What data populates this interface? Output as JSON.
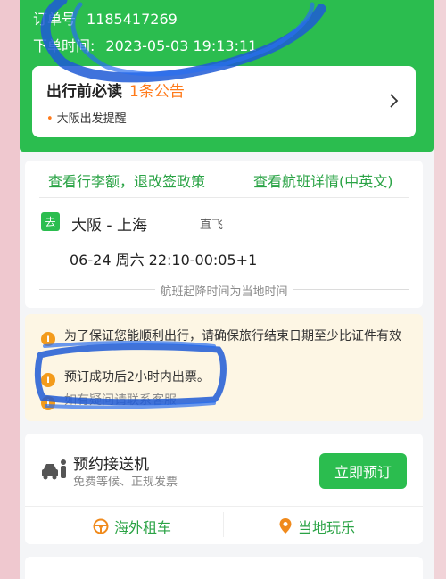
{
  "header": {
    "order_label": "订单号",
    "order_number": "1185417269",
    "order_time_label": "下单时间:",
    "order_time_value": "2023-05-03 19:13:11"
  },
  "notice": {
    "title": "出行前必读",
    "count": "1条公告",
    "item": "大阪出发提醒"
  },
  "flight": {
    "luggage_link": "查看行李额，退改签政策",
    "details_link": "查看航班详情(中英文)",
    "direction_tag": "去",
    "route": "大阪 - 上海",
    "direct_label": "直飞",
    "time": "06-24 周六 22:10-00:05+1",
    "local_time_note": "航班起降时间为当地时间"
  },
  "warnings": [
    "为了保证您能顺利出行，请确保旅行结束日期至少比证件有效",
    "预订成功后2小时内出票。",
    "如有疑问请联系客服"
  ],
  "service": {
    "title": "预约接送机",
    "subtitle": "免费等候、正规发票",
    "book_button": "立即预订",
    "car_rental": "海外租车",
    "local_fun": "当地玩乐"
  },
  "colors": {
    "brand_green": "#2bbd4f",
    "accent_orange": "#ff7a1a",
    "warning_bg": "#fdf6e4",
    "scribble_blue": "#1e5bd6"
  },
  "icons": [
    "chevron-right-icon",
    "info-icon",
    "car-person-icon",
    "steering-wheel-icon",
    "location-pin-icon"
  ]
}
